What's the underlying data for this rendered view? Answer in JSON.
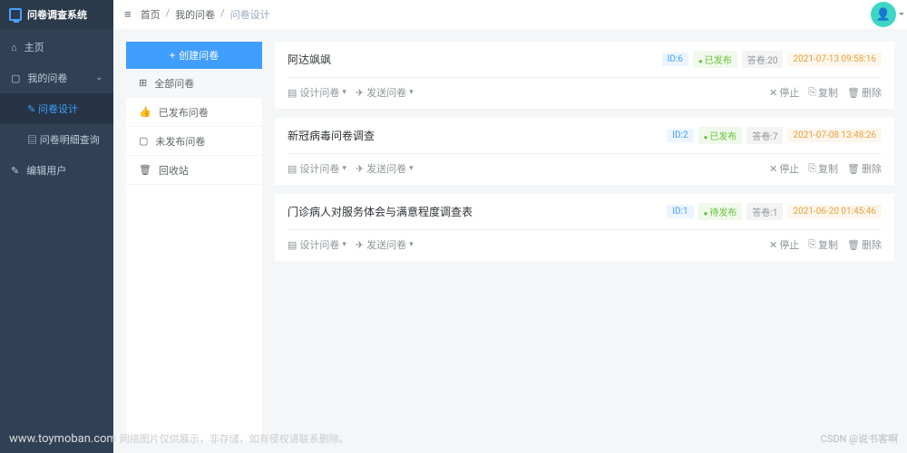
{
  "app": {
    "title": "问卷调查系统"
  },
  "nav": {
    "home": "主页",
    "mine": "我的问卷",
    "design": "问卷设计",
    "detail": "问卷明细查询",
    "user": "编辑用户"
  },
  "breadcrumb": {
    "home": "首页",
    "mine": "我的问卷",
    "current": "问卷设计"
  },
  "panel": {
    "create": "创建问卷",
    "all": "全部问卷",
    "published": "已发布问卷",
    "unpublished": "未发布问卷",
    "trash": "回收站"
  },
  "labels": {
    "design_menu": "设计问卷",
    "send_menu": "发送问卷",
    "stop": "停止",
    "copy": "复制",
    "delete": "删除"
  },
  "surveys": [
    {
      "title": "阿达飒飒",
      "id": "ID:6",
      "status": "已发布",
      "count": "答卷:20",
      "time": "2021-07-13 09:58:16"
    },
    {
      "title": "新冠病毒问卷调查",
      "id": "ID:2",
      "status": "已发布",
      "count": "答卷:7",
      "time": "2021-07-08 13:48:26"
    },
    {
      "title": "门诊病人对服务体会与满意程度调查表",
      "id": "ID:1",
      "status": "待发布",
      "count": "答卷:1",
      "time": "2021-06-20 01:45:46"
    }
  ],
  "footer": {
    "watermark": "www.toymoban.com",
    "text": "网络图片仅供展示，非存储，如有侵权请联系删除。",
    "credit": "CSDN @说书客啊"
  }
}
